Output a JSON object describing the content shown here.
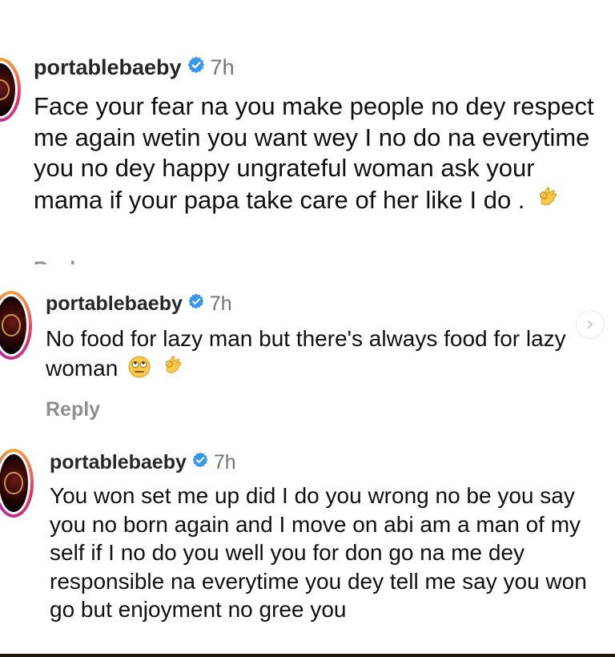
{
  "comments": [
    {
      "username": "portablebaeby",
      "time": "7h",
      "text": "Face your fear na you make people no dey respect me again wetin you want wey I no do na everytime you no dey happy ungrateful woman ask your mama if your papa take care of her like I do .",
      "emojis": [
        "ok-hand"
      ],
      "reply_label": "Reply"
    },
    {
      "username": "portablebaeby",
      "time": "7h",
      "text": "No food for lazy man but there's always food for lazy woman",
      "emojis": [
        "face-with-rolling-eyes",
        "ok-hand"
      ],
      "reply_label": "Reply"
    },
    {
      "username": "portablebaeby",
      "time": "7h",
      "text": "You won set me up did I do you wrong no be you say you no born again and I move on abi am a man of my self if I no do you well you for don go na me dey responsible na everytime you dey tell me say you won go but enjoyment no gree you",
      "emojis": []
    }
  ],
  "icons": {
    "verified": "verified-badge-icon",
    "next": "chevron-right-icon"
  },
  "colors": {
    "verified_blue": "#3797f0",
    "username": "#262626",
    "muted": "#8e8e8e",
    "emoji_yellow": "#f7c948"
  }
}
